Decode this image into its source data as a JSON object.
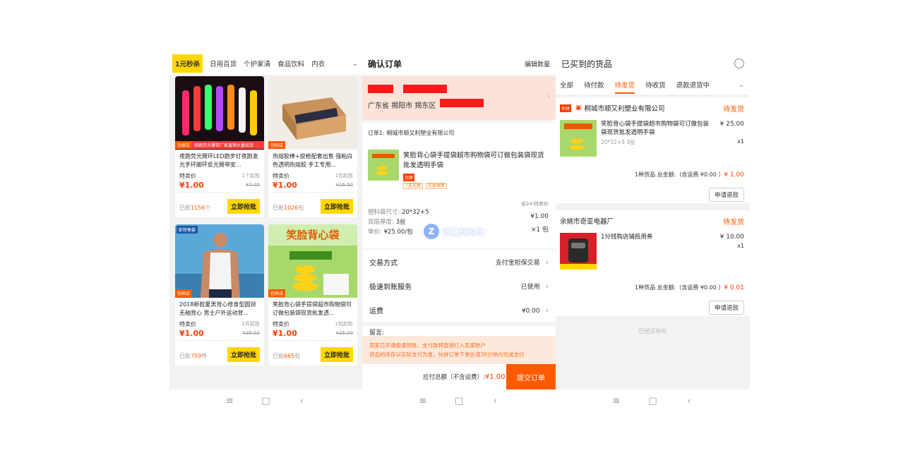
{
  "panel1": {
    "categories": [
      "1元秒杀",
      "日用百货",
      "个护家清",
      "食品饮料",
      "内衣"
    ],
    "more_icon": "chevron-down-icon",
    "products": [
      {
        "tag": "包邮店",
        "strip": "夜跑荧光臂带厂家直销大量现货",
        "title": "夜跑荧光臂环LED跑步灯夜跑发光手环脚环反光臂带安...",
        "label": "特卖价",
        "min": "1个起批",
        "price": "¥1.00",
        "old": "¥7.40",
        "sold": "已批",
        "sold_count": "1156",
        "sold_unit": "个",
        "buy": "立即抢批"
      },
      {
        "tag": "包邮店",
        "strip": "",
        "title": "热熔胶棒+胶枪配套出售 强粘白色透明热熔胶 手工专用...",
        "label": "特卖价",
        "min": "1包起批",
        "price": "¥1.00",
        "old": "¥16.50",
        "sold": "已批",
        "sold_count": "1026",
        "sold_unit": "包",
        "buy": "立即抢批"
      },
      {
        "tag": "包邮店",
        "corner": "即将售罄",
        "strip": "",
        "title": "2018新款夏男背心修身型圆领无袖背心 男士户外运动背...",
        "label": "特卖价",
        "min": "1件起批",
        "price": "¥1.00",
        "old": "¥35.00",
        "sold": "已批",
        "sold_count": "759",
        "sold_unit": "件",
        "buy": "立即抢批"
      },
      {
        "tag": "包邮店",
        "strip": "",
        "title": "笑脸背心袋手提袋超市购物袋可订做包装袋现货批发透...",
        "label": "特卖价",
        "min": "1包起批",
        "price": "¥1.00",
        "old": "¥25.00",
        "sold": "已批",
        "sold_count": "665",
        "sold_unit": "包",
        "buy": "立即抢批",
        "overlay": "笑脸背心袋"
      }
    ]
  },
  "panel2": {
    "title": "确认订单",
    "edit": "编辑数量",
    "address": "广东省 揭阳市 揭东区",
    "shop": "订单1: 桐城市顺又利塑业有限公司",
    "goods_title": "笑脸背心袋手提袋超市购物袋可订做包装袋现货批发透明手袋",
    "goods_badge": "包邮",
    "goods_badges": [
      "7天无理",
      "交易保障"
    ],
    "spec1_label": "塑料袋尺寸:",
    "spec1_value": "20*32+5",
    "spec2_label": "双层厚度:",
    "spec2_value": "3丝",
    "spec3_label": "单价:",
    "spec3_value": "¥25.00/包",
    "save": "省24:特卖价",
    "price": "¥1.00",
    "qty": "×1 包",
    "options": [
      {
        "label": "交易方式",
        "value": "支付宝担保交易"
      },
      {
        "label": "极速到账服务",
        "value": "已使用"
      },
      {
        "label": "运费",
        "value": "¥0.00"
      }
    ],
    "message": "留言:",
    "notice1": "卖家已开通极速到账，支付款将直接打入卖家账户",
    "notice2": "货品的库存以实际支付为准，伙拼订单下单后请30分钟内完成支付",
    "total_label": "应付总额（不含运费）:",
    "total_value": "¥1.00",
    "submit": "提交订单",
    "watermark": "好赚网论坛"
  },
  "panel3": {
    "title": "已买到的货品",
    "tabs": [
      "全部",
      "待付款",
      "待发货",
      "待收货",
      "退款退货中"
    ],
    "active_tab": "待发货",
    "orders": [
      {
        "tag": "伙拼",
        "shop": "桐城市顺又利塑业有限公司",
        "status": "待发货",
        "title": "笑脸背心袋手提袋超市购物袋可订做包装袋现货批发透明手袋",
        "sub": "20*32+5 3丝",
        "price": "¥ 25.00",
        "qty": "x1",
        "sum_label": "1种货品 总金额:（含运费 ¥0.00 ）",
        "sum_value": "¥ 1.00",
        "refund": "申请退款"
      },
      {
        "tag": "",
        "shop": "余姚市奇亚电器厂",
        "status": "待发货",
        "title": "1分钱购店铺抵用券",
        "sub": "",
        "price": "¥ 10.00",
        "qty": "x1",
        "sum_label": "1种货品 总金额:（含运费 ¥0.00 ）",
        "sum_value": "¥ 0.01",
        "refund": "申请退款"
      }
    ],
    "no_more": "已经没有啦"
  },
  "navbar": {
    "menu": "≡",
    "home": "□",
    "back": "‹"
  }
}
